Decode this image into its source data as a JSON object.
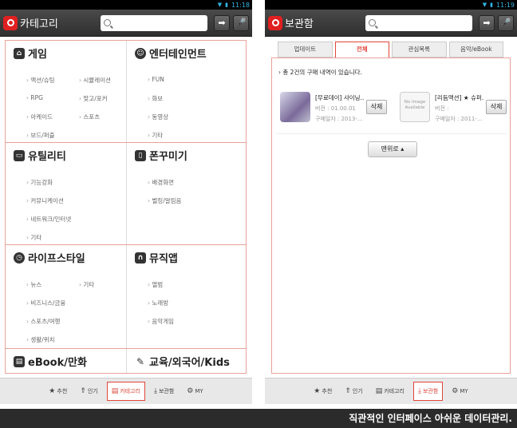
{
  "left": {
    "status": {
      "time": "11:18"
    },
    "app_title": "카테고리",
    "sections": [
      {
        "title": "게임",
        "icon": "gamepad-icon",
        "items": [
          "액션/슈팅",
          "시뮬레이션",
          "RPG",
          "맞고/포커",
          "아케이드",
          "스포츠",
          "보드/퍼즐"
        ]
      },
      {
        "title": "엔터테인먼트",
        "icon": "smiley-icon",
        "items": [
          "FUN",
          "화보",
          "동영상",
          "기타"
        ]
      },
      {
        "title": "유틸리티",
        "icon": "monitor-icon",
        "items": [
          "기능강화",
          "커뮤니케이션",
          "네트워크/인터넷",
          "기타"
        ]
      },
      {
        "title": "폰꾸미기",
        "icon": "phone-decor-icon",
        "items": [
          "배경화면",
          "벨링/알림음"
        ]
      },
      {
        "title": "라이프스타일",
        "icon": "clock-icon",
        "items": [
          "뉴스",
          "기타",
          "비즈니스/금융",
          "스포츠/여행",
          "생활/위치"
        ]
      },
      {
        "title": "뮤직앱",
        "icon": "headphones-icon",
        "items": [
          "앨범",
          "노래방",
          "음악게임"
        ]
      },
      {
        "title": "eBook/만화",
        "icon": "book-icon",
        "items": []
      },
      {
        "title": "교육/외국어/Kids",
        "icon": "pencil-icon",
        "items": []
      }
    ],
    "bottom_nav": [
      "추천",
      "인기",
      "카테고리",
      "보관함",
      "MY"
    ]
  },
  "right": {
    "status": {
      "time": "11:19"
    },
    "app_title": "보관함",
    "tabs": [
      "업데이트",
      "전체",
      "관심목록",
      "음악/eBook"
    ],
    "summary": "› 총 2건의 구매 내역이 있습니다.",
    "cards": [
      {
        "title": "[무료데이] 샤이닝...",
        "version": "버전 : 01.00.01",
        "date": "구매일자 : 2013-...",
        "delete": "삭제"
      },
      {
        "title": "[리듬액션] ★ 슈퍼...",
        "version": "버전 :",
        "date": "구매일자 : 2011-...",
        "delete": "삭제",
        "noimage": "No Image Available"
      }
    ],
    "more": "맨위로 ▴",
    "bottom_nav": [
      "추천",
      "인기",
      "카테고리",
      "보관함",
      "MY"
    ]
  },
  "caption": "직관적인 인터페이스 아쉬운 데이터관리."
}
